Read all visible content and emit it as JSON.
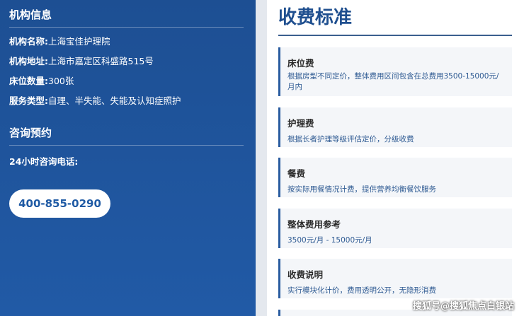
{
  "institution": {
    "section_title": "机构信息",
    "rows": [
      {
        "key": "机构名称:",
        "value": "上海宝佳护理院"
      },
      {
        "key": "机构地址:",
        "value": "上海市嘉定区科盛路515号"
      },
      {
        "key": "床位数量:",
        "value": "300张"
      },
      {
        "key": "服务类型:",
        "value": "自理、半失能、失能及认知症照护"
      }
    ]
  },
  "consult": {
    "section_title": "咨询预约",
    "phone_label": "24小时咨询电话:",
    "phone": "400-855-0290"
  },
  "fees": {
    "title": "收费标准",
    "cards": [
      {
        "title": "床位费",
        "desc": "根据房型不同定价，整体费用区间包含在总费用3500-15000元/月内"
      },
      {
        "title": "护理费",
        "desc": "根据长者护理等级评估定价，分级收费"
      },
      {
        "title": "餐费",
        "desc": "按实际用餐情况计费，提供营养均衡餐饮服务"
      },
      {
        "title": "整体费用参考",
        "desc": "3500元/月 - 15000元/月"
      },
      {
        "title": "收费说明",
        "desc": "实行模块化计价，费用透明公开，无隐形消费"
      }
    ]
  },
  "watermark": "搜狐号@搜狐焦点白银站",
  "colors": {
    "primary": "#1f5aa4",
    "title": "#1f4f8f",
    "card_bg": "#f4f6f9"
  }
}
